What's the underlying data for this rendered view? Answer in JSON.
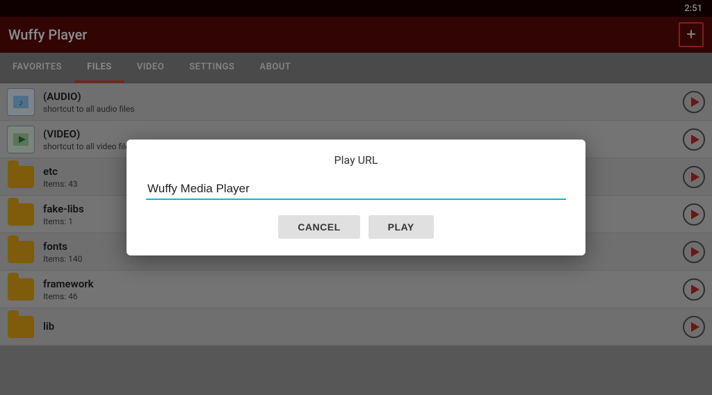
{
  "statusBar": {
    "time": "2:51"
  },
  "toolbar": {
    "title": "Wuffy Player",
    "addButton": "+"
  },
  "tabs": [
    {
      "label": "FAVORITES",
      "active": false
    },
    {
      "label": "FILES",
      "active": true
    },
    {
      "label": "VIDEO",
      "active": false
    },
    {
      "label": "SETTINGS",
      "active": false
    },
    {
      "label": "ABOUT",
      "active": false
    }
  ],
  "fileList": [
    {
      "type": "audio",
      "name": "(AUDIO)",
      "sub": "shortcut to all audio files"
    },
    {
      "type": "video",
      "name": "(VIDEO)",
      "sub": "shortcut to all video files"
    },
    {
      "type": "folder",
      "name": "etc",
      "sub": "Items: 43"
    },
    {
      "type": "folder",
      "name": "fake-libs",
      "sub": "Items: 1"
    },
    {
      "type": "folder",
      "name": "fonts",
      "sub": "Items: 140"
    },
    {
      "type": "folder",
      "name": "framework",
      "sub": "Items: 46"
    },
    {
      "type": "folder",
      "name": "lib",
      "sub": ""
    }
  ],
  "dialog": {
    "title": "Play URL",
    "inputValue": "Wuffy Media Player",
    "inputPlaceholder": "Wuffy Media Player",
    "cancelLabel": "CANCEL",
    "playLabel": "PLAY"
  }
}
